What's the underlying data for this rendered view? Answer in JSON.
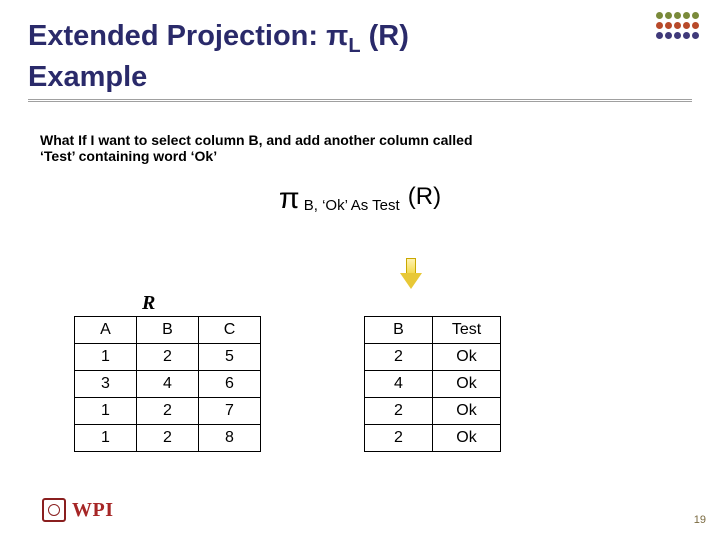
{
  "title_line1": "Extended Projection: π",
  "title_sub": "L",
  "title_after": " (R)",
  "title_line2": "Example",
  "accent_colors": {
    "top": "#7a8a3a",
    "mid": "#b84a2a",
    "bot": "#403a7a"
  },
  "intro": "What If I want to select column B, and add another column called ‘Test’ containing word ‘Ok’",
  "expr": {
    "pi": "π",
    "sub": " B,  ‘Ok’ As Test ",
    "paren": "(R)"
  },
  "R_label": "R",
  "tableR": {
    "headers": [
      "A",
      "B",
      "C"
    ],
    "rows": [
      [
        "1",
        "2",
        "5"
      ],
      [
        "3",
        "4",
        "6"
      ],
      [
        "1",
        "2",
        "7"
      ],
      [
        "1",
        "2",
        "8"
      ]
    ]
  },
  "tableOut": {
    "headers": [
      "B",
      "Test"
    ],
    "rows": [
      [
        "2",
        "Ok"
      ],
      [
        "4",
        "Ok"
      ],
      [
        "2",
        "Ok"
      ],
      [
        "2",
        "Ok"
      ]
    ]
  },
  "pagenum": "19",
  "logo_text": "WPI"
}
